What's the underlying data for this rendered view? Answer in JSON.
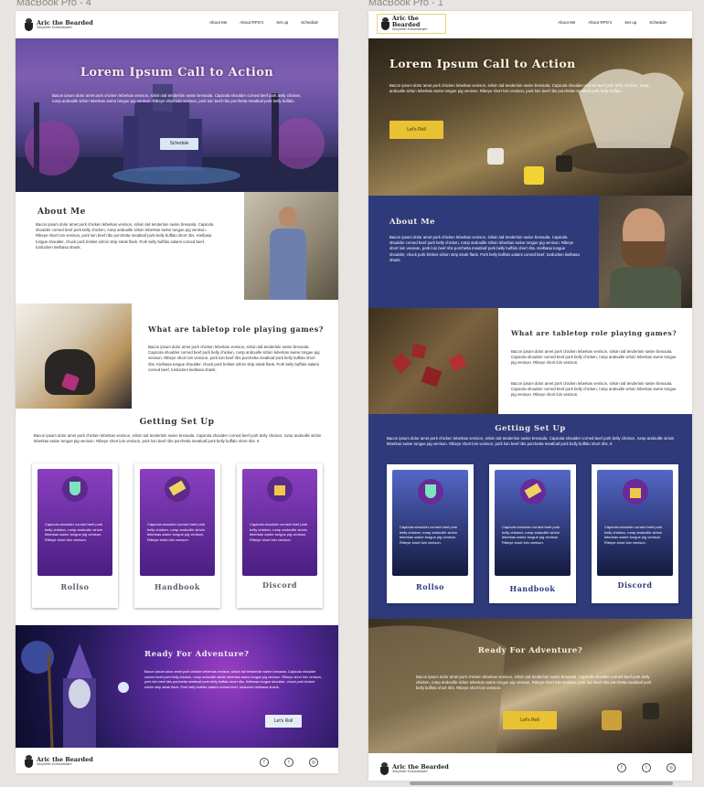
{
  "artboards": [
    {
      "label": "MacBook Pro - 4"
    },
    {
      "label": "MacBook Pro - 1"
    }
  ],
  "brand": {
    "name": "Aric the Bearded",
    "tagline": "Storyteller Extraordinaire"
  },
  "nav": [
    "About Me",
    "About RPG's",
    "Set up",
    "Schedule"
  ],
  "hero": {
    "title": "Lorem Ipsum Call to Action",
    "text": "Bacon ipsum dolor amet pork chicken leberkas venison, sirloin tail tenderloin swine bresaola. Capicola shoulder corned beef pork belly chicken, rump andouille sirloin leberkas swine tongue pig venison. Ribeye short loin venison, pork loin beef ribs porchetta meatloaf pork belly buffalo.",
    "buttonA": "Schedule",
    "buttonB": "Let's Roll"
  },
  "about": {
    "title": "About Me",
    "text": "Bacon ipsum dolor amet pork chicken leberkas venison, sirloin tail tenderloin swine bresaola. Capicola shoulder corned beef pork belly chicken, rump andouille sirloin leberkas swine tongue pig venison. Ribeye short loin venison, pork loin beef ribs porchetta meatloaf pork belly buffalo short ribs. Kielbasa tongue shoulder, chuck pork brisket sirloin strip steak flank. Pork belly buffalo salami corned beef, turducken kielbasa shank."
  },
  "tabletop": {
    "title": "What are tabletop role playing games?",
    "textA": "Bacon ipsum dolor amet pork chicken leberkas venison, sirloin tail tenderloin swine bresaola. Capicola shoulder corned beef pork belly chicken, rump andouille sirloin leberkas swine tongue pig venison. Ribeye short loin venison, pork loin beef ribs porchetta meatloaf pork belly buffalo short ribs. Kielbasa tongue shoulder, chuck pork brisket sirloin strip steak flank. Pork belly buffalo salami corned beef, turducken kielbasa shank.",
    "textB1": "Bacon ipsum dolor amet pork chicken leberkas venison, sirloin tail tenderloin swine bresaola. Capicola shoulder corned beef pork belly chicken, rump andouille sirloin leberkas swine tongue pig venison. Ribeye short loin venison.",
    "textB2": "Bacon ipsum dolor amet pork chicken leberkas venison, sirloin tail tenderloin swine bresaola. Capicola shoulder corned beef pork belly chicken, rump andouille sirloin leberkas swine tongue pig venison. Ribeye short loin venison."
  },
  "setup": {
    "title": "Getting Set Up",
    "text": "Bacon ipsum dolor amet pork chicken leberkas venison, sirloin tail tenderloin swine bresaola. Capicola shoulder corned beef pork belly chicken, rump andouille sirloin leberkas swine tongue pig venison. Ribeye short loin venison, pork loin beef ribs porchetta meatloaf pork belly buffalo short ribs. K",
    "cardText": "Capicola shoulder corned beef pork belly chicken, rump andouille sirloin leberkas swine tongue pig venison. Ribeye short loin venison.",
    "cards": [
      "Rollso",
      "Handbook",
      "Discord"
    ]
  },
  "adventure": {
    "title": "Ready For Adventure?",
    "textA": "Bacon ipsum dolor amet pork chicken leberkas venison, sirloin tail tenderloin swine bresaola. Capicola shoulder corned beef pork belly chicken, rump andouille sirloin leberkas swine tongue pig venison. Ribeye short loin venison, pork loin beef ribs porchetta meatloaf pork belly buffalo short ribs. Kielbasa tongue shoulder, chuck pork brisket sirloin strip steak flank. Pork belly buffalo salami corned beef, turducken kielbasa shank.",
    "textB": "Bacon ipsum dolor amet pork chicken leberkas venison, sirloin tail tenderloin swine bresaola. Capicola shoulder corned beef pork belly chicken, rump andouille sirloin leberkas swine tongue pig venison. Ribeye short loin venison, pork loin beef ribs porchetta meatloaf pork belly buffalo short ribs. Ribeye short loin venison.",
    "button": "Let's Roll"
  },
  "social_icons": [
    "facebook-icon",
    "twitter-icon",
    "instagram-icon"
  ],
  "colors": {
    "navy": "#2f3a7a",
    "gold": "#e9c233",
    "purple": "#6a2a98",
    "cardLabel": "#5e5e6e"
  }
}
